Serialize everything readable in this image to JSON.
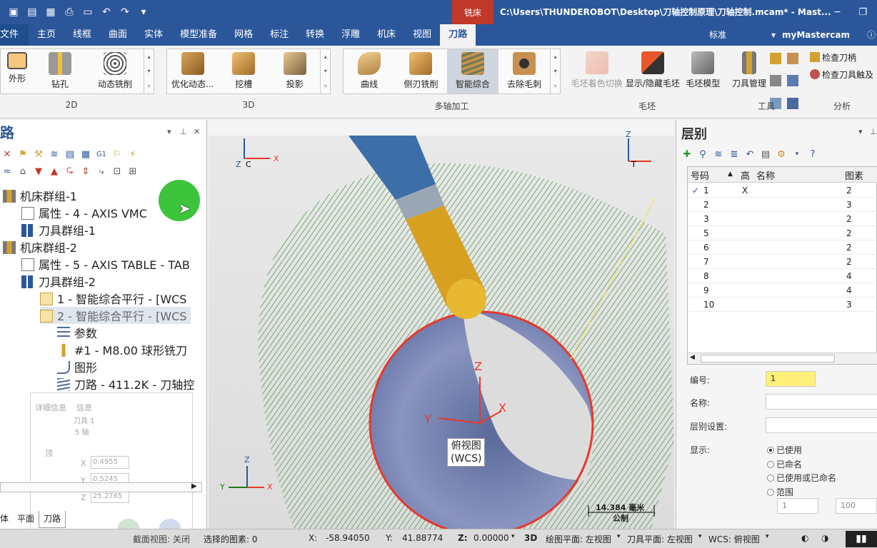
{
  "window": {
    "context_tab": "铣床",
    "title": "C:\\Users\\THUNDEROBOT\\Desktop\\刀轴控制原理\\刀轴控制.mcam* - Mast..."
  },
  "ribbon_tabs": [
    "文件",
    "主页",
    "线框",
    "曲面",
    "实体",
    "模型准备",
    "网格",
    "标注",
    "转换",
    "浮雕",
    "机床",
    "视图",
    "刀路"
  ],
  "ribbon_tab_active": "刀路",
  "ribbon_right": {
    "standard": "标准",
    "account": "myMastercam"
  },
  "ribbon": {
    "group_2d": {
      "title": "2D",
      "buttons": [
        "外形",
        "钻孔",
        "动态铣削"
      ]
    },
    "group_3d": {
      "title": "3D",
      "buttons": [
        "优化动态...",
        "挖槽",
        "投影"
      ]
    },
    "group_multi": {
      "title": "多轴加工",
      "buttons": [
        "曲线",
        "侧刃铣削",
        "智能综合",
        "去除毛刺"
      ]
    },
    "group_stock": {
      "title": "毛坯",
      "buttons": [
        "毛坯着色切换",
        "显示/隐藏毛坯",
        "毛坯模型"
      ]
    },
    "group_tool": {
      "title": "工具",
      "buttons": [
        "刀具管理"
      ]
    },
    "group_analysis": {
      "title": "分析",
      "buttons": [
        "检查刀柄",
        "检查刀具触及"
      ]
    }
  },
  "left_panel": {
    "title": "路",
    "tree": [
      "机床群组-1",
      "属性 - 4 - AXIS VMC",
      "刀具群组-1",
      "机床群组-2",
      "属性 - 5 - AXIS TABLE - TAB",
      "刀具群组-2",
      "1 - 智能综合平行 - [WCS",
      "2 - 智能综合平行 - [WCS",
      "参数",
      "#1 - M8.00 球形铣刀",
      "图形",
      "刀路 - 411.2K - 刀轴控"
    ],
    "bottom_tabs": [
      "体",
      "平面",
      "刀路"
    ],
    "bottom_tab_active": "刀路"
  },
  "overlay": {
    "detail": "详细信息",
    "info": "信息",
    "tool": "刀具 1",
    "axes": "5 轴",
    "vertex": "顶",
    "x_label": "X",
    "y_label": "Y",
    "z_label": "Z",
    "x": "0.4955",
    "y": "0.5245",
    "z": "25.2765"
  },
  "viewport": {
    "view_label_1": "俯视图",
    "view_label_2": "(WCS)",
    "scale": "14.384 毫米",
    "scale_unit": "公制",
    "axis_x": "X",
    "axis_y": "Y",
    "axis_z": "Z",
    "corner_c": "C",
    "corner_t": "T"
  },
  "right_panel": {
    "title": "层别",
    "columns": [
      "号码",
      "高",
      "名称",
      "图素"
    ],
    "rows": [
      {
        "num": "1",
        "high": "X",
        "name": "",
        "count": "2",
        "active": "✓"
      },
      {
        "num": "2",
        "high": "",
        "name": "",
        "count": "3",
        "active": ""
      },
      {
        "num": "3",
        "high": "",
        "name": "",
        "count": "2",
        "active": ""
      },
      {
        "num": "5",
        "high": "",
        "name": "",
        "count": "2",
        "active": ""
      },
      {
        "num": "6",
        "high": "",
        "name": "",
        "count": "2",
        "active": ""
      },
      {
        "num": "7",
        "high": "",
        "name": "",
        "count": "2",
        "active": ""
      },
      {
        "num": "8",
        "high": "",
        "name": "",
        "count": "4",
        "active": ""
      },
      {
        "num": "9",
        "high": "",
        "name": "",
        "count": "4",
        "active": ""
      },
      {
        "num": "10",
        "high": "",
        "name": "",
        "count": "3",
        "active": ""
      }
    ],
    "number_label": "编号:",
    "number_value": "1",
    "name_label": "名称:",
    "level_setting_label": "层别设置:",
    "display_label": "显示:",
    "display_options": [
      "已使用",
      "已命名",
      "已使用或已命名",
      "范围"
    ],
    "range_from": "1",
    "range_to": "100"
  },
  "status": {
    "section_view": "截面视图: 关闭",
    "selected": "选择的图素: 0",
    "x_label": "X:",
    "x": "-58.94050",
    "y_label": "Y:",
    "y": "41.88774",
    "z_label": "Z:",
    "z": "0.00000",
    "mode": "3D",
    "gplane": "绘图平面: 左视图",
    "tplane": "刀具平面: 左视图",
    "wcs": "WCS: 俯视图"
  },
  "colors": {
    "accent": "#2b579a",
    "context": "#c0392b",
    "toolpath": "#1e7a1e",
    "highlight": "#fff07a"
  }
}
